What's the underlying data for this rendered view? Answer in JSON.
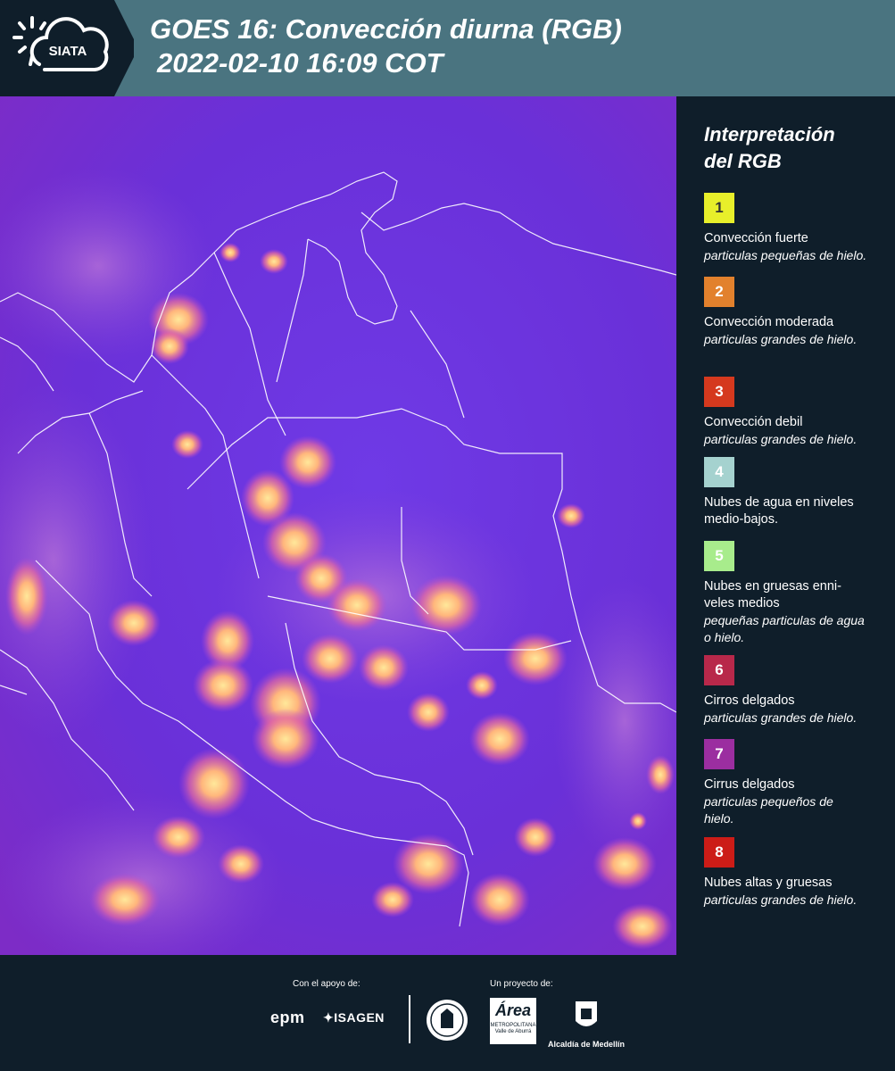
{
  "header": {
    "logo_text": "SIATA",
    "title_line1": "GOES 16: Convección diurna (RGB)",
    "title_line2": "2022-02-10 16:09 COT"
  },
  "legend": {
    "title_line1": "Interpretación",
    "title_line2": "del RGB",
    "items": [
      {
        "number": "1",
        "color": "#e8ef2a",
        "number_color": "#333333",
        "name": "Convección fuerte",
        "desc": "particulas pequeñas de hielo."
      },
      {
        "number": "2",
        "color": "#e2812d",
        "number_color": "#ffffff",
        "name": "Convección moderada",
        "desc": "particulas grandes de hielo."
      },
      {
        "number": "3",
        "color": "#d5391e",
        "number_color": "#ffffff",
        "name": "Convección debil",
        "desc": "particulas grandes de hielo."
      },
      {
        "number": "4",
        "color": "#a5d2cf",
        "number_color": "#ffffff",
        "name": "Nubes de agua en niveles medio-bajos.",
        "desc": ""
      },
      {
        "number": "5",
        "color": "#a8ec8c",
        "number_color": "#ffffff",
        "name": "Nubes en gruesas enni-veles medios",
        "desc": "pequeñas particulas de agua o hielo."
      },
      {
        "number": "6",
        "color": "#b8284a",
        "number_color": "#ffffff",
        "name": "Cirros delgados",
        "desc": "particulas grandes de hielo."
      },
      {
        "number": "7",
        "color": "#9b2ea0",
        "number_color": "#ffffff",
        "name": "Cirrus delgados",
        "desc": "particulas pequeños de hielo."
      },
      {
        "number": "8",
        "color": "#cc1c17",
        "number_color": "#ffffff",
        "name": "Nubes altas y gruesas",
        "desc": "particulas grandes de hielo."
      }
    ]
  },
  "footer": {
    "support_label": "Con el apoyo de:",
    "project_label": "Un proyecto de:",
    "epm": "epm",
    "isagen": "ISAGEN",
    "area_text": "Área",
    "area_sub": "METROPOLITANA Valle de Aburrá",
    "alcaldia": "Alcaldía de Medellín"
  }
}
